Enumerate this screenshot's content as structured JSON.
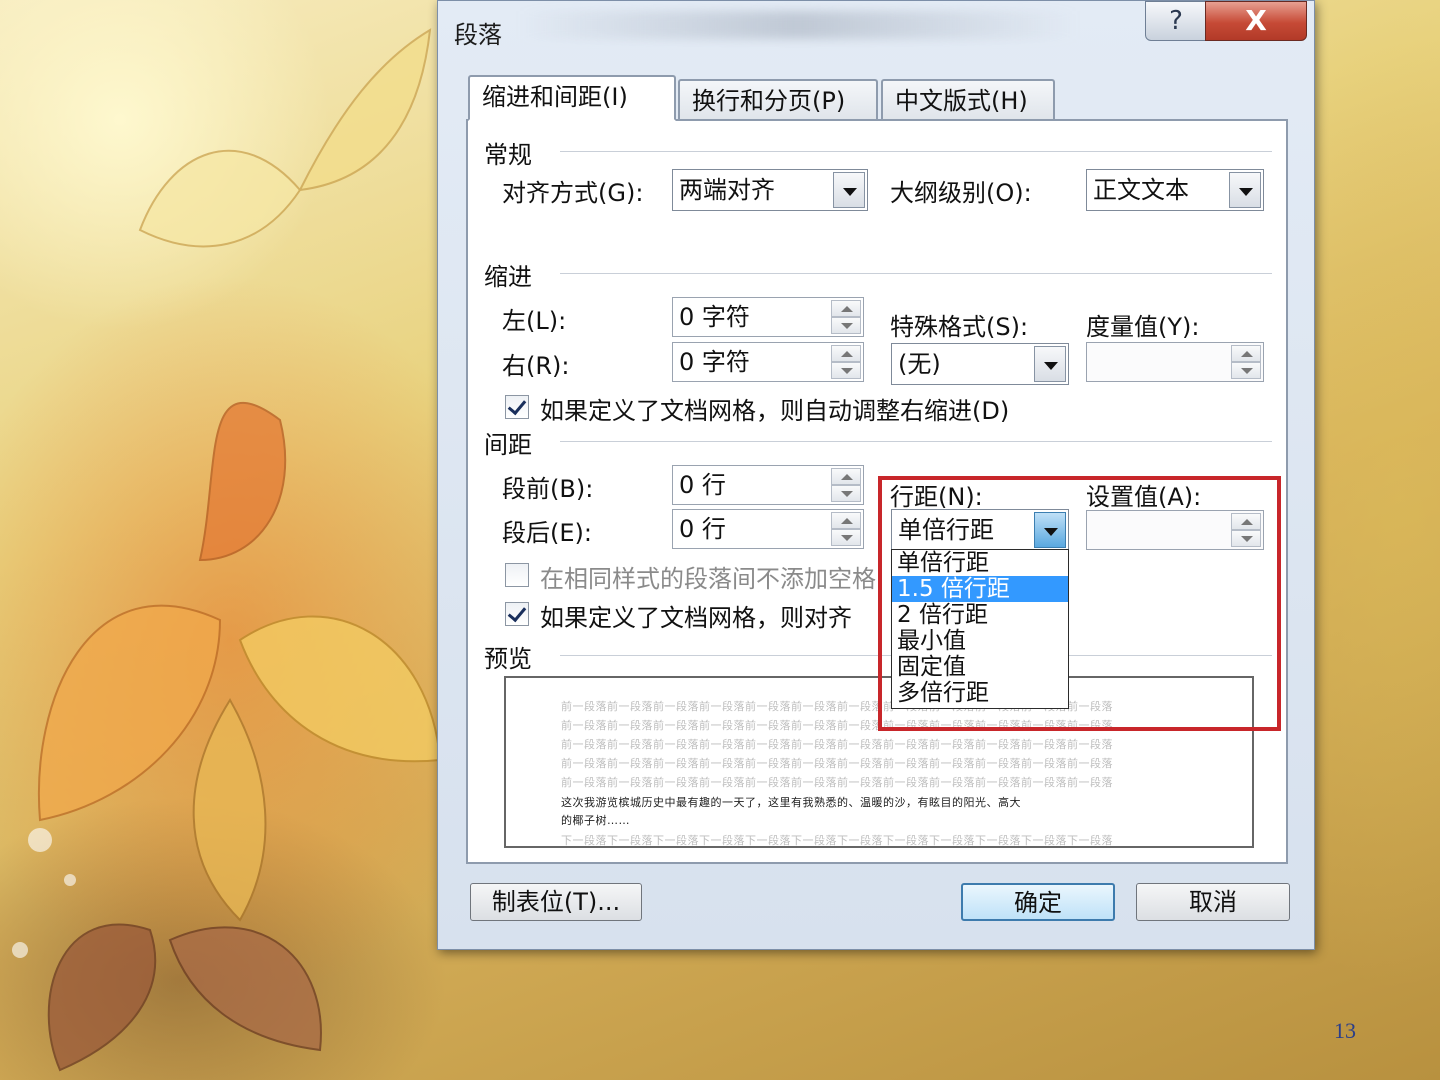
{
  "slide": {
    "page_number": "13"
  },
  "dialog": {
    "title": "段落",
    "help_glyph": "?",
    "close_glyph": "X",
    "tabs": [
      {
        "label": "缩进和间距(I)",
        "active": true
      },
      {
        "label": "换行和分页(P)",
        "active": false
      },
      {
        "label": "中文版式(H)",
        "active": false
      }
    ],
    "general": {
      "heading": "常规",
      "alignment_label": "对齐方式(G):",
      "alignment_value": "两端对齐",
      "outline_label": "大纲级别(O):",
      "outline_value": "正文文本"
    },
    "indent": {
      "heading": "缩进",
      "left_label": "左(L):",
      "left_value": "0 字符",
      "right_label": "右(R):",
      "right_value": "0 字符",
      "special_label": "特殊格式(S):",
      "special_value": "(无)",
      "measure_label": "度量值(Y):",
      "measure_value": "",
      "auto_adjust_label": "如果定义了文档网格，则自动调整右缩进(D)",
      "auto_adjust_checked": true
    },
    "spacing": {
      "heading": "间距",
      "before_label": "段前(B):",
      "before_value": "0 行",
      "after_label": "段后(E):",
      "after_value": "0 行",
      "line_spacing_label": "行距(N):",
      "line_spacing_value": "单倍行距",
      "set_value_label": "设置值(A):",
      "set_value_value": "",
      "no_space_label": "在相同样式的段落间不添加空格",
      "no_space_checked": false,
      "snap_grid_label": "如果定义了文档网格，则对齐",
      "snap_grid_checked": true,
      "line_spacing_options": [
        "单倍行距",
        "1.5 倍行距",
        "2 倍行距",
        "最小值",
        "固定值",
        "多倍行距"
      ],
      "selected_option": "1.5 倍行距"
    },
    "preview": {
      "heading": "预览",
      "prev_text": "前一段落前一段落前一段落前一段落前一段落前一段落前一段落前一段落前一段落前一段落前一段落前一段落",
      "body_line1": "这次我游览槟城历史中最有趣的一天了，这里有我熟悉的、温暖的沙，有眩目的阳光、高大",
      "body_line2": "的椰子树……",
      "next_text": "下一段落下一段落下一段落下一段落下一段落下一段落下一段落下一段落下一段落下一段落下一段落下一段落"
    },
    "buttons": {
      "tabs_label": "制表位(T)...",
      "ok_label": "确定",
      "cancel_label": "取消"
    }
  },
  "colors": {
    "highlight": "#c8262a",
    "selection": "#3399ff",
    "page_number": "#2a3e8a"
  }
}
